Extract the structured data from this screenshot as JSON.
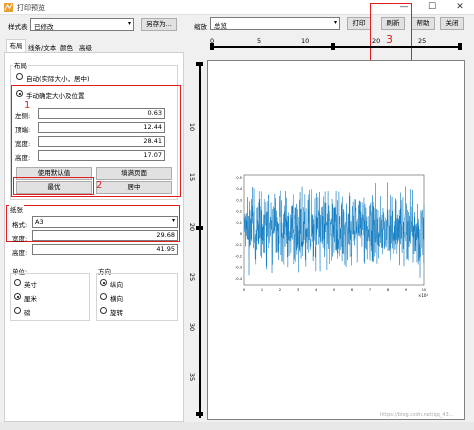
{
  "window": {
    "title": "打印预览",
    "minimize": "—",
    "maximize": "☐",
    "close": "✕"
  },
  "toolbar": {
    "style_sheet_label": "样式表",
    "style_sheet_value": "已修改",
    "save_as": "另存为...",
    "zoom_label": "缩放",
    "zoom_value": "总览",
    "print": "打印",
    "refresh": "刷新",
    "help": "帮助",
    "close": "关闭"
  },
  "tabs": [
    "布局",
    "线条/文本",
    "颜色",
    "高级"
  ],
  "layout": {
    "group_title": "布局",
    "auto_option": "自动(实际大小，居中)",
    "manual_option": "手动确定大小及位置",
    "fields": [
      {
        "label": "左侧:",
        "value": "0.63"
      },
      {
        "label": "顶端:",
        "value": "12.44"
      },
      {
        "label": "宽度:",
        "value": "28.41"
      },
      {
        "label": "高度:",
        "value": "17.07"
      }
    ],
    "use_default": "使用默认值",
    "fill_page": "填满页面",
    "best_fit": "最优",
    "center": "居中"
  },
  "paper": {
    "group_title": "纸张",
    "format_label": "格式:",
    "format_value": "A3",
    "width_label": "宽度:",
    "width_value": "29.68",
    "height_label": "高度:",
    "height_value": "41.95"
  },
  "units": {
    "title": "单位:",
    "options": [
      "英寸",
      "厘米",
      "磅"
    ],
    "selected": 1
  },
  "orientation": {
    "title": "方向",
    "options": [
      "纵向",
      "横向",
      "旋转"
    ],
    "selected": 0
  },
  "annotations": {
    "a1": "1",
    "a2": "2",
    "a3": "3"
  },
  "ruler_top": [
    "0",
    "5",
    "10",
    "15",
    "20",
    "25"
  ],
  "ruler_left": [
    "5",
    "10",
    "15",
    "20",
    "25",
    "30",
    "35",
    "40"
  ],
  "plot": {
    "y_ticks": [
      "0.5",
      "0.4",
      "0.3",
      "0.2",
      "0.1",
      "0",
      "-0.1",
      "-0.2",
      "-0.3",
      "-0.4"
    ],
    "x_ticks": [
      "0",
      "1",
      "2",
      "3",
      "4",
      "5",
      "6",
      "7",
      "8",
      "9",
      "10"
    ],
    "x_exponent": "×10⁴",
    "color": "#0072bd"
  },
  "watermark": "https://blog.csdn.net/qq_43..."
}
